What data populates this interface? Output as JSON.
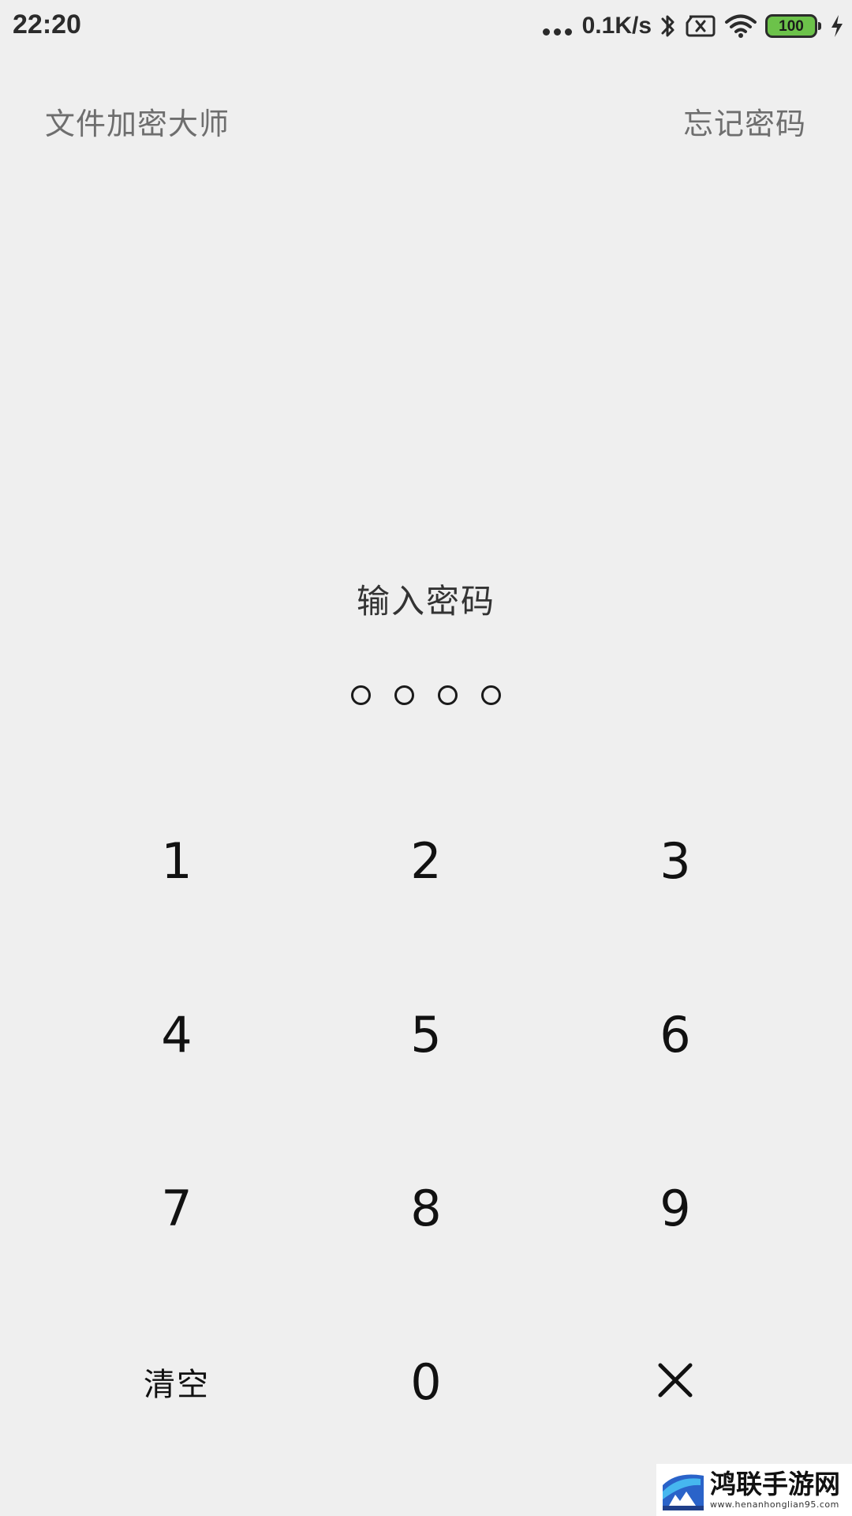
{
  "status_bar": {
    "time": "22:20",
    "net_speed": "0.1K/s",
    "battery_level": "100",
    "icons": [
      "signal-dots-icon",
      "bluetooth-icon",
      "no-sim-icon",
      "wifi-icon",
      "battery-icon",
      "charging-icon"
    ]
  },
  "header": {
    "app_title": "文件加密大师",
    "forgot_label": "忘记密码"
  },
  "lock": {
    "prompt": "输入密码",
    "pin_length": 4,
    "entered": 0
  },
  "keypad": {
    "keys": [
      "1",
      "2",
      "3",
      "4",
      "5",
      "6",
      "7",
      "8",
      "9"
    ],
    "zero": "0",
    "clear_label": "清空",
    "delete_icon": "close-icon"
  },
  "watermark": {
    "title": "鸿联手游网",
    "url": "www.henanhonglian95.com"
  },
  "colors": {
    "background": "#efefef",
    "text_primary": "#111111",
    "text_secondary": "#6e6e6e",
    "battery_green": "#6cc24a"
  }
}
